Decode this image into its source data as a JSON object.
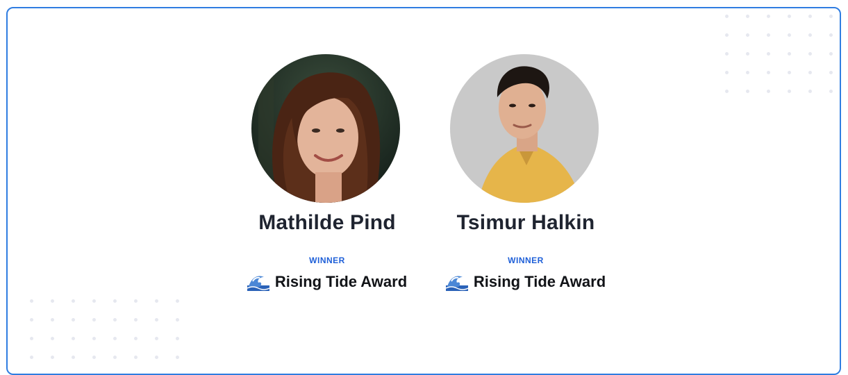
{
  "winners": [
    {
      "name": "Mathilde Pind",
      "label": "WINNER",
      "award": "Rising Tide Award",
      "award_icon": "wave-icon"
    },
    {
      "name": "Tsimur Halkin",
      "label": "WINNER",
      "award": "Rising Tide Award",
      "award_icon": "wave-icon"
    }
  ],
  "colors": {
    "card_border": "#2f7de1",
    "label": "#1e5fd8",
    "name": "#1f2430",
    "dots": "#e6e8ef"
  }
}
